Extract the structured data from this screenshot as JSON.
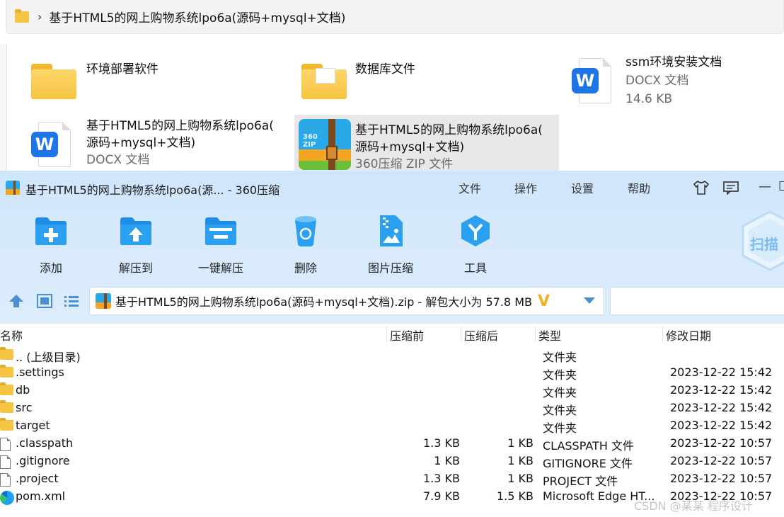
{
  "explorer": {
    "breadcrumb_sep": "›",
    "breadcrumb": "基于HTML5的网上购物系统lpo6a(源码+mysql+文档)",
    "items": [
      {
        "name": "环境部署软件",
        "icon": "folder-icon"
      },
      {
        "name": "数据库文件",
        "icon": "folder-icon"
      },
      {
        "name": "ssm环境安装文档",
        "type": "DOCX 文档",
        "size": "14.6 KB",
        "icon": "wps-word-icon"
      },
      {
        "name_line1": "基于HTML5的网上购物系统lpo6a(",
        "name_line2": "源码+mysql+文档)",
        "type": "DOCX 文档",
        "icon": "wps-word-icon"
      },
      {
        "name_line1": "基于HTML5的网上购物系统lpo6a(",
        "name_line2": "源码+mysql+文档)",
        "type": "360压缩 ZIP 文件",
        "icon": "360zip-icon"
      }
    ]
  },
  "zipwin": {
    "title": "基于HTML5的网上购物系统lpo6a(源... - 360压缩",
    "menu": [
      "文件",
      "操作",
      "设置",
      "帮助"
    ],
    "window_controls": {
      "minimize": "—",
      "maximize": "☐"
    },
    "toolbar": [
      {
        "label": "添加",
        "icon": "add-icon"
      },
      {
        "label": "解压到",
        "icon": "extract-to-icon"
      },
      {
        "label": "一键解压",
        "icon": "one-click-extract-icon"
      },
      {
        "label": "删除",
        "icon": "delete-icon"
      },
      {
        "label": "图片压缩",
        "icon": "image-compress-icon"
      },
      {
        "label": "工具",
        "icon": "tools-icon"
      }
    ],
    "scan_label": "扫描",
    "address": {
      "path": "基于HTML5的网上购物系统lpo6a(源码+mysql+文档).zip - 解包大小为 57.8 MB",
      "vip": "V"
    },
    "columns": {
      "name": "名称",
      "before": "压缩前",
      "after": "压缩后",
      "type": "类型",
      "date": "修改日期"
    },
    "rows": [
      {
        "icon": "folder",
        "name": ".. (上级目录)",
        "before": "",
        "after": "",
        "type": "文件夹",
        "date": ""
      },
      {
        "icon": "folder",
        "name": ".settings",
        "before": "",
        "after": "",
        "type": "文件夹",
        "date": "2023-12-22 15:42"
      },
      {
        "icon": "folder",
        "name": "db",
        "before": "",
        "after": "",
        "type": "文件夹",
        "date": "2023-12-22 15:42"
      },
      {
        "icon": "folder",
        "name": "src",
        "before": "",
        "after": "",
        "type": "文件夹",
        "date": "2023-12-22 15:42"
      },
      {
        "icon": "folder",
        "name": "target",
        "before": "",
        "after": "",
        "type": "文件夹",
        "date": "2023-12-22 15:42"
      },
      {
        "icon": "file",
        "name": ".classpath",
        "before": "1.3 KB",
        "after": "1 KB",
        "type": "CLASSPATH 文件",
        "date": "2023-12-22 10:57"
      },
      {
        "icon": "file",
        "name": ".gitignore",
        "before": "1 KB",
        "after": "1 KB",
        "type": "GITIGNORE 文件",
        "date": "2023-12-22 10:57"
      },
      {
        "icon": "file",
        "name": ".project",
        "before": "1.3 KB",
        "after": "1 KB",
        "type": "PROJECT 文件",
        "date": "2023-12-22 10:57"
      },
      {
        "icon": "edge",
        "name": "pom.xml",
        "before": "7.9 KB",
        "after": "1.5 KB",
        "type": "Microsoft Edge HT...",
        "date": "2023-12-22 10:57"
      }
    ]
  },
  "watermark": "CSDN @某某 程序设计"
}
